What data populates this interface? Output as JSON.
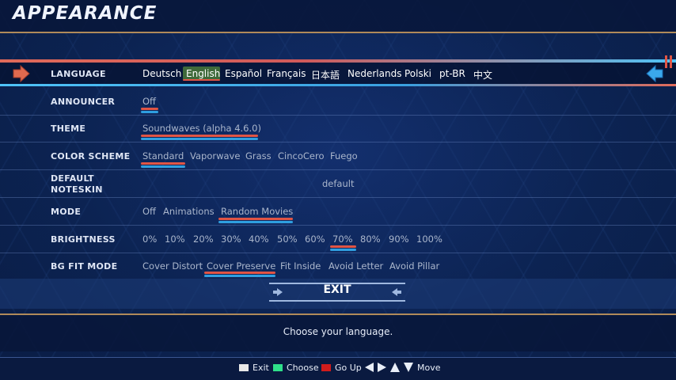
{
  "screen": {
    "title": "APPEARANCE"
  },
  "rows": {
    "language": {
      "label": "LANGUAGE",
      "options": [
        "Deutsch",
        "English",
        "Español",
        "Français",
        "日本語",
        "Nederlands",
        "Polski",
        "pt-BR",
        "中文"
      ]
    },
    "announcer": {
      "label": "ANNOUNCER",
      "options": [
        "Off"
      ]
    },
    "theme": {
      "label": "THEME",
      "options": [
        "Soundwaves (alpha 4.6.0)"
      ]
    },
    "color_scheme": {
      "label": "COLOR SCHEME",
      "options": [
        "Standard",
        "Vaporwave",
        "Grass",
        "CincoCero",
        "Fuego"
      ]
    },
    "default_noteskin": {
      "label_line1": "DEFAULT",
      "label_line2": "NOTESKIN",
      "options": [
        "default"
      ]
    },
    "mode": {
      "label": "MODE",
      "options": [
        "Off",
        "Animations",
        "Random Movies"
      ]
    },
    "brightness": {
      "label": "BRIGHTNESS",
      "options": [
        "0%",
        "10%",
        "20%",
        "30%",
        "40%",
        "50%",
        "60%",
        "70%",
        "80%",
        "90%",
        "100%"
      ]
    },
    "bg_fit_mode": {
      "label": "BG FIT MODE",
      "options": [
        "Cover Distort",
        "Cover Preserve",
        "Fit Inside",
        "Avoid Letter",
        "Avoid Pillar"
      ]
    }
  },
  "exit": {
    "label": "EXIT"
  },
  "info": {
    "text": "Choose your language."
  },
  "footer": {
    "exit_label": "Exit",
    "choose_label": "Choose",
    "goup_label": "Go Up",
    "move_label": "Move",
    "colors": {
      "exit": "#e8e8e8",
      "choose": "#2fe08a",
      "goup": "#d01c1c"
    }
  },
  "colors": {
    "player1_underline": "#e05545",
    "player2_underline": "#2f9fe0",
    "accent_line": "#b08a5a"
  }
}
